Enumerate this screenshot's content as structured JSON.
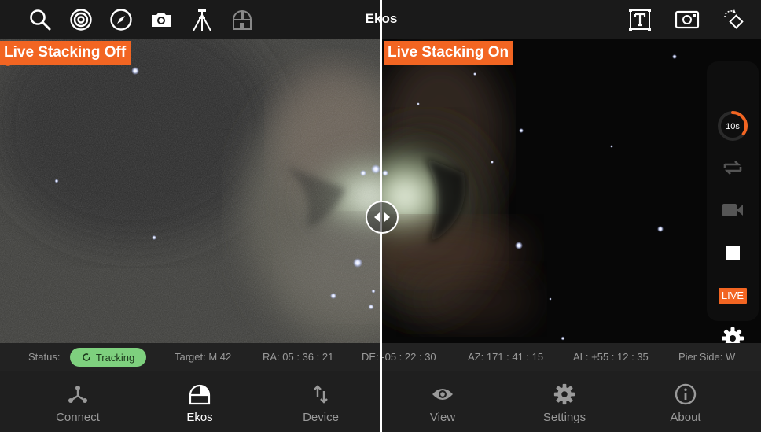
{
  "app": {
    "title": "Ekos"
  },
  "toolbar": {
    "left_icons": [
      "search-icon",
      "target-icon",
      "compass-icon",
      "camera-icon",
      "tripod-icon",
      "observatory-icon"
    ],
    "right_icons": [
      "text-frame-icon",
      "screenshot-frame-icon",
      "rotate-icon"
    ]
  },
  "comparison": {
    "left_label": "Live Stacking Off",
    "right_label": "Live Stacking On"
  },
  "side_panel": {
    "exposure_label": "10s",
    "exposure_progress": 0.35,
    "live_label": "LIVE",
    "icons": [
      "loop-icon",
      "video-icon",
      "stop-icon",
      "settings-icon"
    ]
  },
  "status": {
    "status_label": "Status:",
    "tracking_label": "Tracking",
    "target": "Target: M 42",
    "ra": "RA: 05 : 36 : 21",
    "de": "DE: -05 : 22 : 30",
    "az": "AZ: 171 : 41 : 15",
    "al": "AL: +55 : 12 : 35",
    "pier": "Pier Side: W"
  },
  "nav": {
    "items": [
      {
        "label": "Connect",
        "icon": "connect-icon"
      },
      {
        "label": "Ekos",
        "icon": "ekos-icon"
      },
      {
        "label": "Device",
        "icon": "device-icon"
      },
      {
        "label": "View",
        "icon": "eye-icon"
      },
      {
        "label": "Settings",
        "icon": "gear-icon"
      },
      {
        "label": "About",
        "icon": "info-icon"
      }
    ],
    "active": "Ekos"
  },
  "colors": {
    "accent": "#f26522",
    "tracking_bg": "#7ed07e",
    "background": "#1a1a1a"
  }
}
